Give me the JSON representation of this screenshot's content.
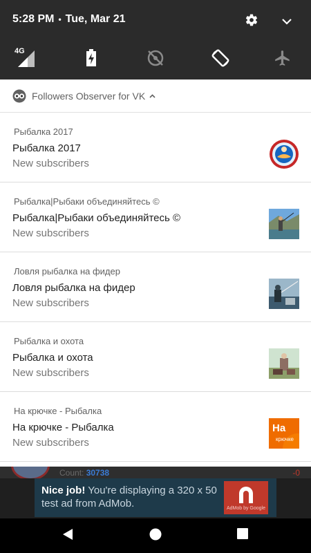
{
  "status": {
    "time": "5:28 PM",
    "separator": "•",
    "date": "Tue, Mar 21",
    "network_label": "4G"
  },
  "quick_settings": {
    "settings_icon": "gear-icon",
    "expand_icon": "chevron-down-icon",
    "tiles": [
      "signal-4g-icon",
      "battery-charging-icon",
      "location-off-icon",
      "auto-rotate-icon",
      "airplane-mode-icon"
    ]
  },
  "app": {
    "name": "Followers Observer for VK",
    "icon": "owl-icon",
    "expand_icon": "chevron-up-icon"
  },
  "notifications": [
    {
      "header": "Рыбалка 2017",
      "title": "Рыбалка 2017",
      "text": "New subscribers",
      "thumb": "group-logo-round"
    },
    {
      "header": "Рыбалка|Рыбаки объединяйтесь  ©",
      "title": "Рыбалка|Рыбаки объединяйтесь  ©",
      "text": "New subscribers",
      "thumb": "fishing-photo"
    },
    {
      "header": "Ловля рыбалка на фидер",
      "title": "Ловля рыбалка на фидер",
      "text": "New subscribers",
      "thumb": "feeder-photo"
    },
    {
      "header": "Рыбалка и охота",
      "title": "Рыбалка и охота",
      "text": "New subscribers",
      "thumb": "hunting-photo"
    },
    {
      "header": "На крючке - Рыбалка",
      "title": "На крючке - Рыбалка",
      "text": "New subscribers",
      "thumb": "na-kryuchke-logo",
      "thumb_text": "На",
      "thumb_subtext": "крючке"
    }
  ],
  "peek": {
    "count_label": "Count:",
    "count_value": "30738",
    "delta": "-0"
  },
  "ad": {
    "bold": "Nice job!",
    "message": " You're displaying a 320 x 50 test ad from AdMob.",
    "badge_caption": "AdMob by Google"
  },
  "colors": {
    "ad_background": "#1e3a4a",
    "ad_badge": "#c0392b",
    "count_value": "#3a7bd5"
  },
  "nav": {
    "back": "back-icon",
    "home": "home-icon",
    "recents": "recents-icon"
  }
}
